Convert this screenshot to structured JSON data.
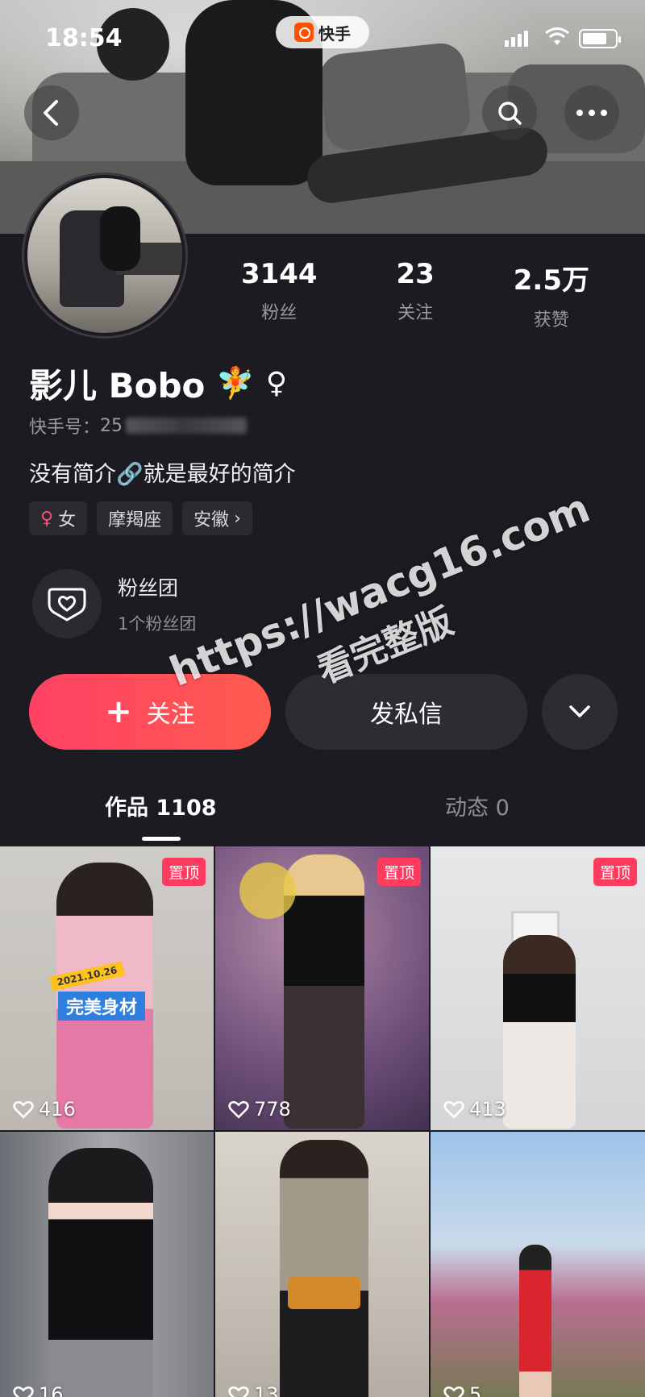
{
  "status_bar": {
    "time": "18:54",
    "app_name": "快手"
  },
  "profile": {
    "stats": [
      {
        "value": "3144",
        "label": "粉丝"
      },
      {
        "value": "23",
        "label": "关注"
      },
      {
        "value": "2.5万",
        "label": "获赞"
      }
    ],
    "name": "影儿 Bobo",
    "kuaishou_id_label": "快手号：",
    "kuaishou_id_visible": "25",
    "bio": "没有简介🔗就是最好的简介",
    "tags": [
      {
        "icon": "female-symbol",
        "label": "女"
      },
      {
        "label": "摩羯座"
      },
      {
        "label": "安徽",
        "chevron": "›"
      }
    ],
    "fan_club": {
      "title": "粉丝团",
      "subtitle": "1个粉丝团"
    }
  },
  "actions": {
    "follow": "关注",
    "follow_icon": "+",
    "message": "发私信"
  },
  "tabs": [
    {
      "label": "作品 1108",
      "active": true
    },
    {
      "label": "动态 0",
      "active": false
    }
  ],
  "works": [
    {
      "likes": "416",
      "pinned": "置顶",
      "overlay_title": "完美身材",
      "overlay_date": "2021.10.26"
    },
    {
      "likes": "778",
      "pinned": "置顶"
    },
    {
      "likes": "413",
      "pinned": "置顶"
    },
    {
      "likes": "16"
    },
    {
      "likes": "13"
    },
    {
      "likes": "5"
    }
  ],
  "watermark": {
    "url": "https://wacg16.com",
    "text": "看完整版"
  },
  "colors": {
    "accent": "#ff4165",
    "background": "#1c1b22",
    "pin": "#ff3b5f"
  }
}
